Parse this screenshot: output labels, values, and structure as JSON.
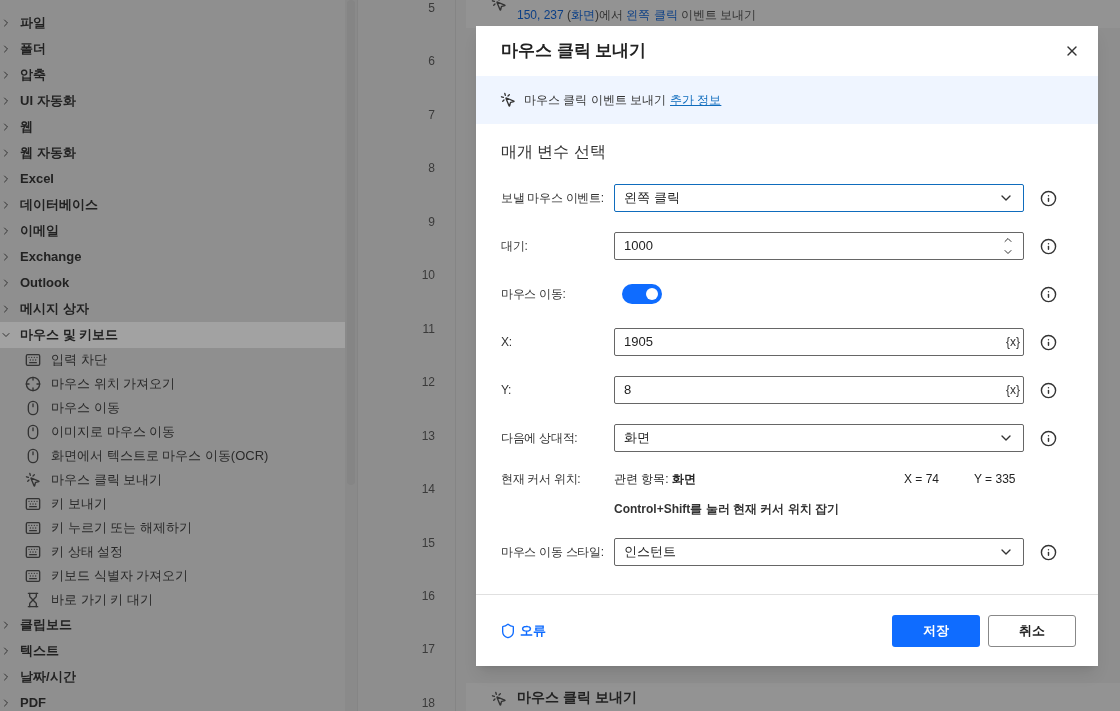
{
  "sidebar": {
    "groups": [
      {
        "label": "파일",
        "expanded": false,
        "selected": false
      },
      {
        "label": "폴더",
        "expanded": false,
        "selected": false
      },
      {
        "label": "압축",
        "expanded": false,
        "selected": false
      },
      {
        "label": "UI 자동화",
        "expanded": false,
        "selected": false
      },
      {
        "label": "웹",
        "expanded": false,
        "selected": false
      },
      {
        "label": "웹 자동화",
        "expanded": false,
        "selected": false
      },
      {
        "label": "Excel",
        "expanded": false,
        "selected": false
      },
      {
        "label": "데이터베이스",
        "expanded": false,
        "selected": false
      },
      {
        "label": "이메일",
        "expanded": false,
        "selected": false
      },
      {
        "label": "Exchange",
        "expanded": false,
        "selected": false
      },
      {
        "label": "Outlook",
        "expanded": false,
        "selected": false
      },
      {
        "label": "메시지 상자",
        "expanded": false,
        "selected": false
      },
      {
        "label": "마우스 및 키보드",
        "expanded": true,
        "selected": true,
        "children": [
          {
            "label": "입력 차단",
            "kind": "keyboard"
          },
          {
            "label": "마우스 위치 가져오기",
            "kind": "target"
          },
          {
            "label": "마우스 이동",
            "kind": "mouse"
          },
          {
            "label": "이미지로 마우스 이동",
            "kind": "mouse"
          },
          {
            "label": "화면에서 텍스트로 마우스 이동(OCR)",
            "kind": "mouse"
          },
          {
            "label": "마우스 클릭 보내기",
            "kind": "click"
          },
          {
            "label": "키 보내기",
            "kind": "keyboard"
          },
          {
            "label": "키 누르기 또는 해제하기",
            "kind": "keyboard"
          },
          {
            "label": "키 상태 설정",
            "kind": "keyboard"
          },
          {
            "label": "키보드 식별자 가져오기",
            "kind": "keyboard"
          },
          {
            "label": "바로 가기 키 대기",
            "kind": "hourglass"
          }
        ]
      },
      {
        "label": "클립보드",
        "expanded": false,
        "selected": false
      },
      {
        "label": "텍스트",
        "expanded": false,
        "selected": false
      },
      {
        "label": "날짜/시간",
        "expanded": false,
        "selected": false
      },
      {
        "label": "PDF",
        "expanded": false,
        "selected": false
      }
    ]
  },
  "line_numbers": [
    "5",
    "6",
    "7",
    "8",
    "9",
    "10",
    "11",
    "12",
    "13",
    "14",
    "15",
    "16",
    "17",
    "18"
  ],
  "steps": [
    {
      "subtitle": [
        {
          "text": "150, 237",
          "kind": "token"
        },
        {
          "text": " (",
          "kind": "plain"
        },
        {
          "text": "화면",
          "kind": "token"
        },
        {
          "text": ")에서 ",
          "kind": "plain"
        },
        {
          "text": "왼쪽 클릭",
          "kind": "token"
        },
        {
          "text": " 이벤트 보내기",
          "kind": "plain"
        }
      ]
    },
    {
      "title": "마우스 클릭 보내기"
    }
  ],
  "dialog": {
    "title": "마우스 클릭 보내기",
    "info_bar": {
      "text": "마우스 클릭 이벤트 보내기",
      "link": "추가 정보"
    },
    "section_title": "매개 변수 선택",
    "fields": [
      {
        "kind": "select",
        "label": "보낼 마우스 이벤트:",
        "value": "왼쪽 클릭",
        "focused": true
      },
      {
        "kind": "number",
        "label": "대기:",
        "value": "1000"
      },
      {
        "kind": "toggle",
        "label": "마우스 이동:",
        "on": true
      },
      {
        "kind": "variable",
        "label": "X:",
        "value": "1905",
        "variable_button": "{x}"
      },
      {
        "kind": "variable",
        "label": "Y:",
        "value": "8",
        "variable_button": "{x}"
      },
      {
        "kind": "select",
        "label": "다음에 상대적:",
        "value": "화면",
        "focused": false
      },
      {
        "kind": "cursor",
        "label": "현재 커서 위치:",
        "relative": "관련 항목: **화면**",
        "x": "X = 74",
        "y": "Y = 335",
        "hint": "Control+Shift를 눌러 현재 커서 위치 잡기"
      },
      {
        "kind": "select",
        "label": "마우스 이동 스타일:",
        "value": "인스턴트",
        "focused": false
      }
    ],
    "error_link": "오류",
    "save": "저장",
    "cancel": "취소"
  }
}
